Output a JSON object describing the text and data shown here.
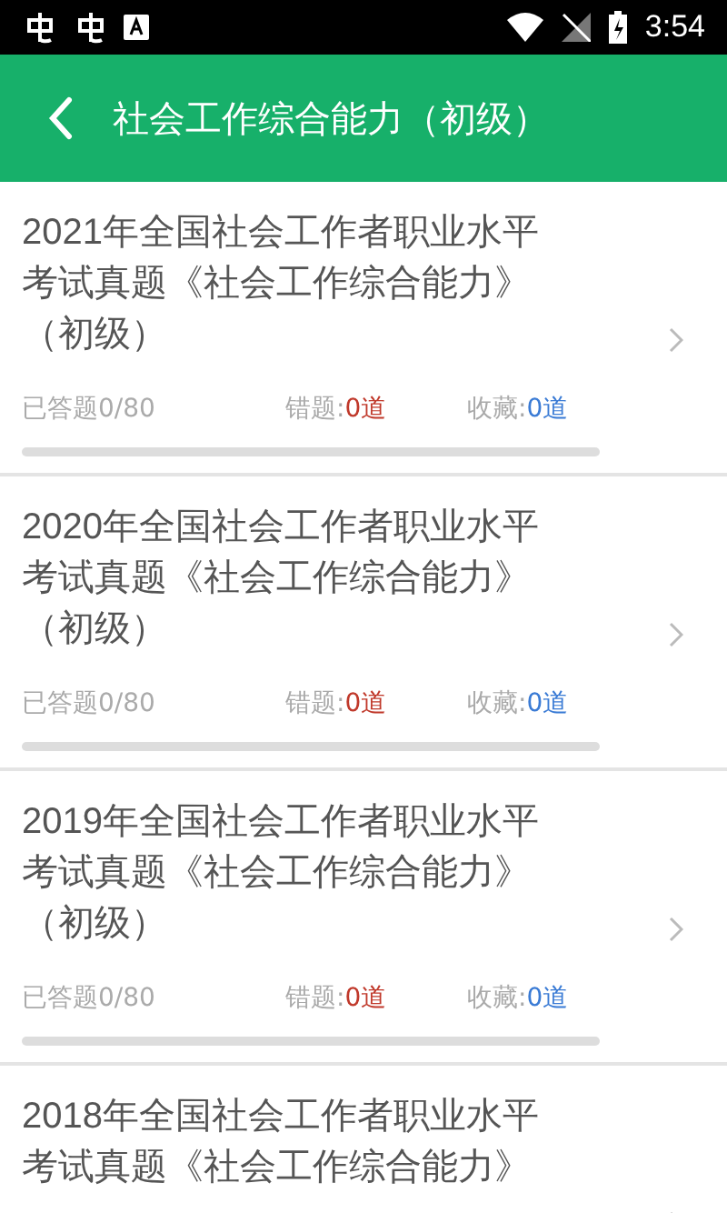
{
  "status_bar": {
    "time": "3:54"
  },
  "header": {
    "title": "社会工作综合能力（初级）"
  },
  "papers": [
    {
      "title_lines": [
        "2021年全国社会工作者职业水平",
        "考试真题《社会工作综合能力》",
        "（初级）"
      ],
      "answered": "已答题0/80",
      "wrong_label": "错题:",
      "wrong_count": "0道",
      "fav_label": "收藏:",
      "fav_count": "0道",
      "level": 0
    },
    {
      "title_lines": [
        "2020年全国社会工作者职业水平",
        "考试真题《社会工作综合能力》",
        "（初级）"
      ],
      "answered": "已答题0/80",
      "wrong_label": "错题:",
      "wrong_count": "0道",
      "fav_label": "收藏:",
      "fav_count": "0道",
      "level": 0
    },
    {
      "title_lines": [
        "2019年全国社会工作者职业水平",
        "考试真题《社会工作综合能力》",
        "（初级）"
      ],
      "answered": "已答题0/80",
      "wrong_label": "错题:",
      "wrong_count": "0道",
      "fav_label": "收藏:",
      "fav_count": "0道",
      "level": 0
    },
    {
      "title_lines": [
        "2018年全国社会工作者职业水平",
        "考试真题《社会工作综合能力》"
      ]
    }
  ]
}
